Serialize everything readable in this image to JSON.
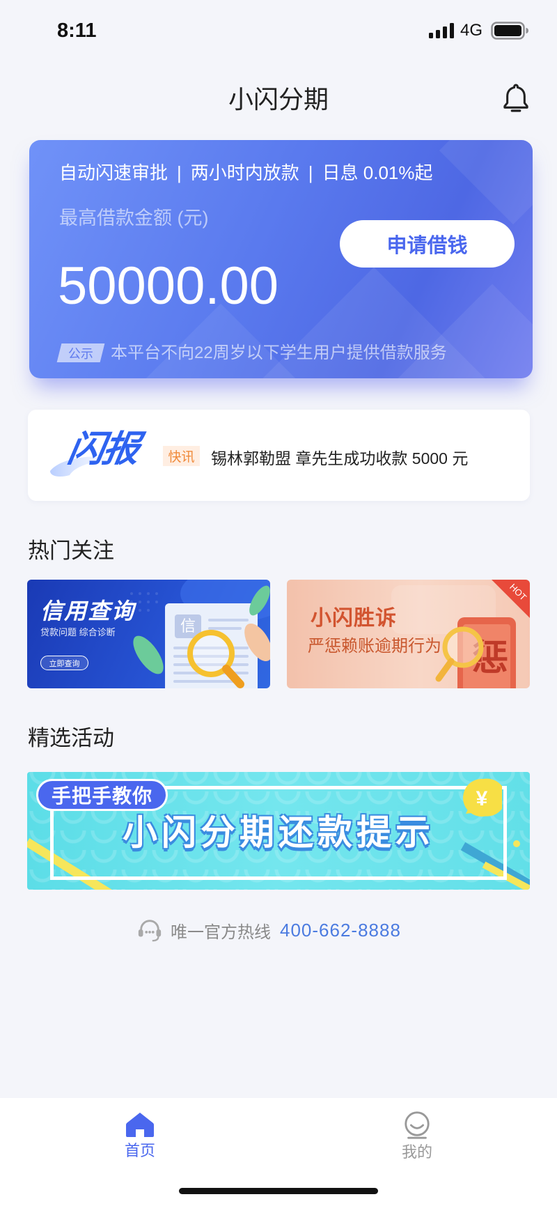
{
  "status_bar": {
    "time": "8:11",
    "network": "4G",
    "signal_icon": "signal-bars-icon",
    "battery_icon": "battery-icon"
  },
  "header": {
    "title": "小闪分期",
    "notification_icon": "bell-icon"
  },
  "loan_card": {
    "features": [
      "自动闪速审批",
      "两小时内放款",
      "日息 0.01%起"
    ],
    "separator": "|",
    "amount_label": "最高借款金额 (元)",
    "amount": "50000.00",
    "apply_button": "申请借钱",
    "notice_badge": "公示",
    "notice_text": "本平台不向22周岁以下学生用户提供借款服务"
  },
  "news_ticker": {
    "logo_text": "闪报",
    "badge": "快讯",
    "message": "锡林郭勒盟 章先生成功收款 5000 元"
  },
  "hot_section": {
    "title": "热门关注",
    "cards": [
      {
        "title": "信用查询",
        "subtitle": "贷款问题 综合诊断",
        "button": "立即查询",
        "doc_stamp": "信",
        "icon": "magnifier-document-icon"
      },
      {
        "title": "小闪胜诉",
        "subtitle": "严惩赖账逾期行为",
        "corner_tag": "HOT",
        "phone_stamp": "惩",
        "icon": "magnifier-phone-icon"
      }
    ]
  },
  "activity_section": {
    "title": "精选活动",
    "banner": {
      "tag": "手把手教你",
      "headline": "小闪分期还款提示",
      "coin_symbol": "¥"
    }
  },
  "hotline": {
    "icon": "headset-icon",
    "label": "唯一官方热线",
    "number": "400-662-8888"
  },
  "tab_bar": {
    "items": [
      {
        "label": "首页",
        "icon": "home-icon",
        "active": true
      },
      {
        "label": "我的",
        "icon": "profile-icon",
        "active": false
      }
    ]
  },
  "colors": {
    "page_background": "#F4F5FA",
    "primary": "#4A67EE",
    "card_gradient_start": "#7092F8",
    "card_gradient_end": "#4E68E4",
    "link_blue": "#4B7BE0",
    "badge_orange": "#F08A3A",
    "badge_orange_bg": "#FFEEE2",
    "text_dark": "#222222",
    "text_muted": "#999999",
    "hot_red": "#E84A3A"
  }
}
